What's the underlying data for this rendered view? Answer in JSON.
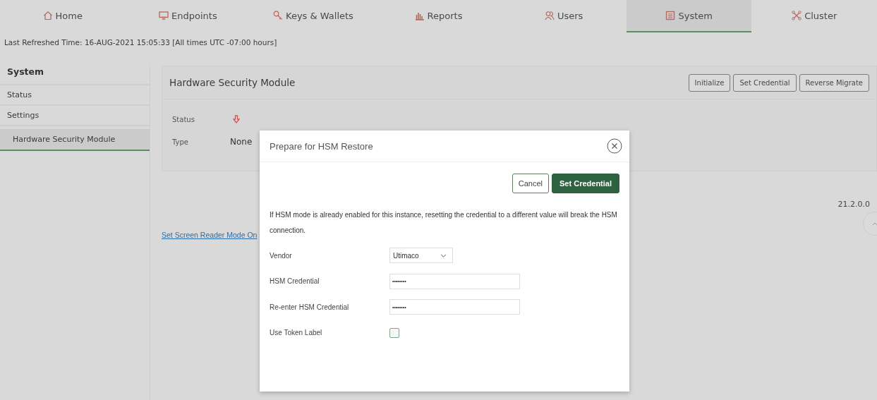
{
  "tabs": [
    {
      "label": "Home",
      "selected": false
    },
    {
      "label": "Endpoints",
      "selected": false
    },
    {
      "label": "Keys & Wallets",
      "selected": false
    },
    {
      "label": "Reports",
      "selected": false
    },
    {
      "label": "Users",
      "selected": false
    },
    {
      "label": "System",
      "selected": true
    },
    {
      "label": "Cluster",
      "selected": false
    }
  ],
  "refresh_line": "Last Refreshed Time: 16-AUG-2021 15:05:33 [All times UTC -07:00 hours]",
  "sidebar": {
    "title": "System",
    "items": [
      {
        "label": "Status",
        "selected": false
      },
      {
        "label": "Settings",
        "selected": false
      },
      {
        "label": "Hardware Security Module",
        "selected": true
      }
    ]
  },
  "panel": {
    "title": "Hardware Security Module",
    "buttons": [
      "Initialize",
      "Set Credential",
      "Reverse Migrate"
    ],
    "rows": [
      {
        "label": "Status",
        "kind": "icon"
      },
      {
        "label": "Type",
        "kind": "text",
        "value": "None"
      }
    ]
  },
  "screen_reader_link": "Set Screen Reader Mode On",
  "version": "21.2.0.0",
  "dialog": {
    "title": "Prepare for HSM Restore",
    "buttons": [
      {
        "label": "Cancel",
        "kind": "secondary"
      },
      {
        "label": "Set Credential",
        "kind": "primary"
      }
    ],
    "message": "If HSM mode is already enabled for this instance, resetting the credential to a different value will break the HSM connection.",
    "fields": [
      {
        "label": "Vendor",
        "kind": "select",
        "value": "Utimaco"
      },
      {
        "label": "HSM Credential",
        "kind": "password",
        "value": "••••••••"
      },
      {
        "label": "Re-enter HSM Credential",
        "kind": "password",
        "value": "••••••••"
      },
      {
        "label": "Use Token Label",
        "kind": "checkbox",
        "checked": false
      }
    ]
  }
}
